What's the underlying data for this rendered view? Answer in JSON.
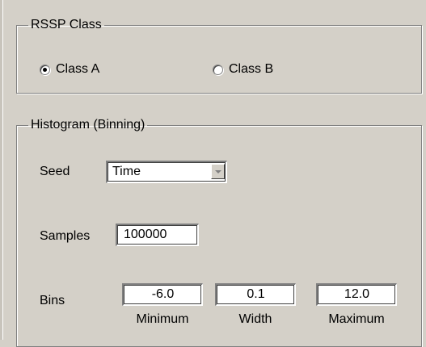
{
  "rssp_class": {
    "legend": "RSSP Class",
    "options": [
      {
        "label": "Class A",
        "checked": true
      },
      {
        "label": "Class B",
        "checked": false
      }
    ]
  },
  "histogram": {
    "legend": "Histogram (Binning)",
    "seed": {
      "label": "Seed",
      "value": "Time",
      "icon": "chevron-down-icon"
    },
    "samples": {
      "label": "Samples",
      "value": "100000"
    },
    "bins": {
      "label": "Bins",
      "minimum": {
        "value": "-6.0",
        "caption": "Minimum"
      },
      "width": {
        "value": "0.1",
        "caption": "Width"
      },
      "maximum": {
        "value": "12.0",
        "caption": "Maximum"
      }
    }
  }
}
